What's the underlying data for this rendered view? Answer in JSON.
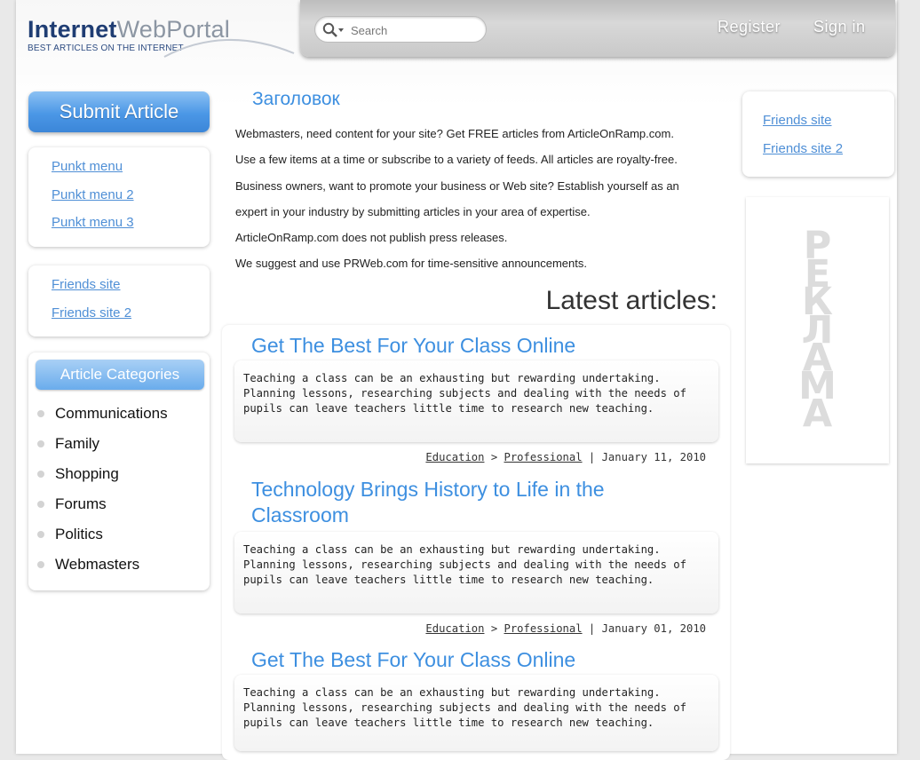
{
  "logo": {
    "part1": "Internet",
    "part2": "WebPortal",
    "tagline": "BEST ARTICLES ON THE INTERNET"
  },
  "header": {
    "search_placeholder": "Search",
    "register": "Register",
    "sign_in": "Sign in"
  },
  "sidebar": {
    "submit": "Submit Article",
    "menu": [
      "Punkt menu",
      "Punkt menu 2",
      "Punkt menu 3"
    ],
    "friends": [
      "Friends site",
      "Friends site 2"
    ],
    "categories_title": "Article Categories",
    "categories": [
      "Communications",
      "Family",
      "Shopping",
      "Forums",
      "Politics",
      "Webmasters"
    ]
  },
  "main": {
    "heading": "Заголовок",
    "intro": [
      "Webmasters, need content for your site? Get FREE articles from ArticleOnRamp.com.",
      "Use a few items at a time or subscribe to a variety of feeds. All articles are royalty-free.",
      "Business owners, want to promote your business or Web site? Establish yourself as an",
      "expert in your industry by submitting articles in your area of expertise.",
      "ArticleOnRamp.com does not publish press releases.",
      "We suggest and use PRWeb.com  for time-sensitive announcements."
    ],
    "latest_title": "Latest articles:",
    "articles": [
      {
        "title": "Get The Best For Your Class Online",
        "body": "Teaching a class can be an exhausting but rewarding undertaking. Planning lessons, researching subjects and dealing with the needs of pupils can leave teachers little time to research new teaching.",
        "category": "Education",
        "separator": ">",
        "subcategory": "Professional",
        "pipe": "|",
        "date": "January 11, 2010"
      },
      {
        "title": "Technology Brings History to Life in the Classroom",
        "body": "Teaching a class can be an exhausting but rewarding undertaking. Planning lessons, researching subjects and dealing with the needs of pupils can leave teachers little time to research new teaching.",
        "category": "Education",
        "separator": ">",
        "subcategory": "Professional",
        "pipe": "|",
        "date": "January 01, 2010"
      },
      {
        "title": "Get The Best For Your Class Online",
        "body": "Teaching a class can be an exhausting but rewarding undertaking. Planning lessons, researching subjects and dealing with the needs of pupils can leave teachers little time to research new teaching."
      }
    ]
  },
  "right": {
    "friends": [
      "Friends site",
      "Friends site 2"
    ],
    "ad_letters": [
      "Р",
      "Е",
      "К",
      "Л",
      "А",
      "М",
      "А"
    ]
  }
}
